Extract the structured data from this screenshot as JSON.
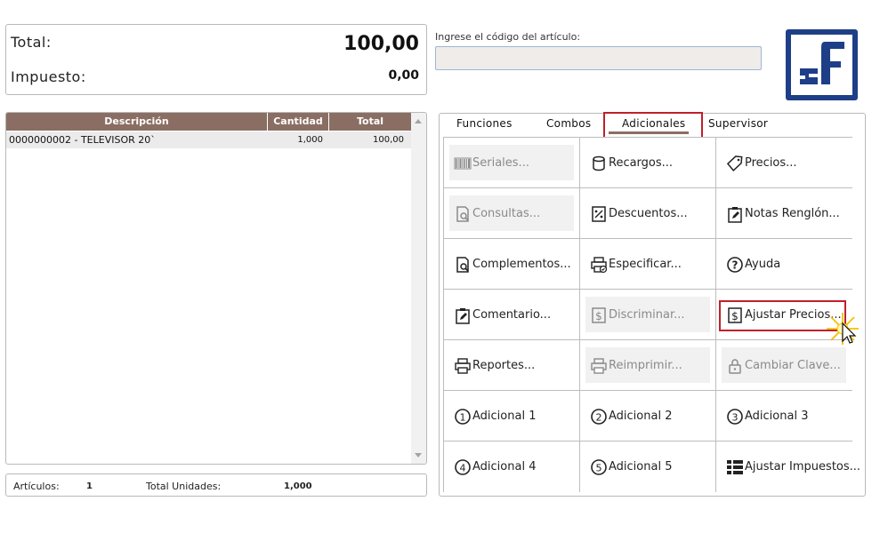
{
  "totals": {
    "total_label": "Total:",
    "total_value": "100,00",
    "tax_label": "Impuesto:",
    "tax_value": "0,00"
  },
  "code_entry": {
    "label": "Ingrese el código del artículo:",
    "value": ""
  },
  "logo": {
    "icon": "brand-logo",
    "color": "#1e3f87"
  },
  "grid": {
    "headers": [
      "Descripción",
      "Cantidad",
      "Total"
    ],
    "rows": [
      {
        "description": "0000000002 - TELEVISOR 20`",
        "quantity": "1,000",
        "total": "100,00"
      }
    ],
    "header_color": "#8b6e63"
  },
  "footer": {
    "articles_label": "Artículos:",
    "articles_value": "1",
    "units_label": "Total Unidades:",
    "units_value": "1,000"
  },
  "tabs": [
    {
      "label": "Funciones"
    },
    {
      "label": "Combos"
    },
    {
      "label": "Adicionales",
      "active": true
    },
    {
      "label": "Supervisor"
    }
  ],
  "buttons": [
    {
      "label": "Seriales...",
      "icon": "barcode-icon",
      "enabled": false
    },
    {
      "label": "Recargos...",
      "icon": "cylinder-icon",
      "enabled": true
    },
    {
      "label": "Precios...",
      "icon": "price-tag-icon",
      "enabled": true
    },
    {
      "label": "Consultas...",
      "icon": "document-search-icon",
      "enabled": false
    },
    {
      "label": "Descuentos...",
      "icon": "percent-icon",
      "enabled": true
    },
    {
      "label": "Notas Renglón...",
      "icon": "clipboard-edit-icon",
      "enabled": true
    },
    {
      "label": "Complementos...",
      "icon": "document-search-icon",
      "enabled": true
    },
    {
      "label": "Especificar...",
      "icon": "printer-check-icon",
      "enabled": true
    },
    {
      "label": "Ayuda",
      "icon": "help-icon",
      "enabled": true
    },
    {
      "label": "Comentario...",
      "icon": "clipboard-edit-icon",
      "enabled": true
    },
    {
      "label": "Discriminar...",
      "icon": "dollar-document-icon",
      "enabled": false
    },
    {
      "label": "Ajustar Precios...",
      "icon": "dollar-document-icon",
      "enabled": true,
      "highlighted": true
    },
    {
      "label": "Reportes...",
      "icon": "printer-icon",
      "enabled": true
    },
    {
      "label": "Reimprimir...",
      "icon": "printer-icon",
      "enabled": false
    },
    {
      "label": "Cambiar Clave...",
      "icon": "lock-icon",
      "enabled": false
    },
    {
      "label": "Adicional 1",
      "icon": "circle-1-icon",
      "enabled": true
    },
    {
      "label": "Adicional 2",
      "icon": "circle-2-icon",
      "enabled": true
    },
    {
      "label": "Adicional 3",
      "icon": "circle-3-icon",
      "enabled": true
    },
    {
      "label": "Adicional 4",
      "icon": "circle-4-icon",
      "enabled": true
    },
    {
      "label": "Adicional 5",
      "icon": "circle-5-icon",
      "enabled": true
    },
    {
      "label": "Ajustar Impuestos...",
      "icon": "grid-list-icon",
      "enabled": true
    }
  ],
  "accent_color": "#c0202a"
}
